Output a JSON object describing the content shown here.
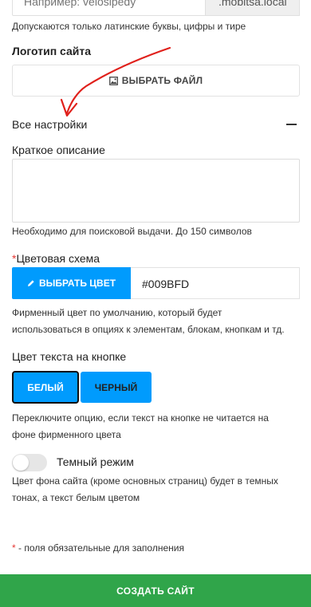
{
  "domain": {
    "placeholder": "Например: velosipedy",
    "suffix": ".mobitsa.local",
    "help": "Допускаются только латинские буквы, цифры и тире"
  },
  "logo": {
    "label": "Логотип сайта",
    "button_label": "ВЫБРАТЬ ФАЙЛ",
    "button_icon": "image-icon"
  },
  "all_settings": {
    "label": "Все настройки",
    "toggle_icon": "minus-icon"
  },
  "short_description": {
    "label": "Краткое описание",
    "value": "",
    "help": "Необходимо для поисковой выдачи. До 150 символов"
  },
  "color_scheme": {
    "required_mark": "*",
    "label": "Цветовая схема",
    "button_label": "ВЫБРАТЬ ЦВЕТ",
    "button_icon": "pencil-icon",
    "value": "#009BFD",
    "help_line1": "Фирменный цвет по умолчанию, который будет",
    "help_line2": "использоваться в опциях к элементам, блокам, кнопкам и тд."
  },
  "button_text_color": {
    "label": "Цвет текста на кнопке",
    "options": [
      "БЕЛЫЙ",
      "ЧЕРНЫЙ"
    ],
    "selected": "БЕЛЫЙ",
    "help_line1": "Переключите опцию, если текст на кнопке не читается на",
    "help_line2": "фоне фирменного цвета"
  },
  "dark_mode": {
    "label": "Темный режим",
    "enabled": false,
    "help_line1": "Цвет фона сайта (кроме основных страниц) будет в темных",
    "help_line2": "тонах, а текст белым цветом"
  },
  "required_note": {
    "mark": "*",
    "text": " - поля обязательные для заполнения"
  },
  "submit": {
    "label": "СОЗДАТЬ САЙТ"
  },
  "colors": {
    "accent": "#009BFD",
    "submit": "#30A54A",
    "annotation_arrow": "#E0201B"
  }
}
